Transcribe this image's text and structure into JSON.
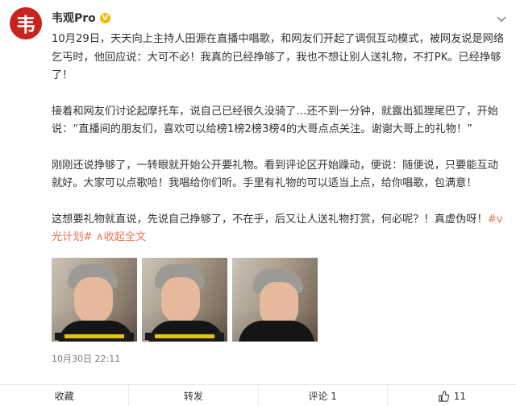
{
  "author": {
    "name": "韦观Pro",
    "avatar_glyph": "韦",
    "badge": "V"
  },
  "post": {
    "paragraphs": [
      "10月29日，天天向上主持人田源在直播中唱歌，和网友们开起了调侃互动模式，被网友说是网络乞丐时，他回应说：大可不必！我真的已经挣够了，我也不想让别人送礼物，不打PK。已经挣够了！",
      "接着和网友们讨论起摩托车，说自己已经很久没骑了…还不到一分钟，就露出狐狸尾巴了，开始说：“直播间的朋友们，喜欢可以给榜1榜2榜3榜4的大哥点点关注。谢谢大哥上的礼物！”",
      "刚刚还说挣够了，一转眼就开始公开要礼物。看到评论区开始躁动，便说：随便说，只要能互动就好。大家可以点歌哈！我唱给你们听。手里有礼物的可以适当上点，给你唱歌，包满意！"
    ],
    "last_paragraph": "这想要礼物就直说，先说自己挣够了，不在乎，后又让人送礼物打赏，何必呢？！真虚伪呀！",
    "topic_tag": "#v光计划#",
    "collapse_link": "收起全文",
    "collapse_symbol": "∧"
  },
  "photos": [
    {
      "alt": "田源直播截图1"
    },
    {
      "alt": "田源直播截图2"
    },
    {
      "alt": "田源直播截图3"
    }
  ],
  "timestamp": "10月30日 22:11",
  "actions": {
    "favorite": "收藏",
    "repost": "转发",
    "comment": "评论 1",
    "like_count": "11"
  }
}
